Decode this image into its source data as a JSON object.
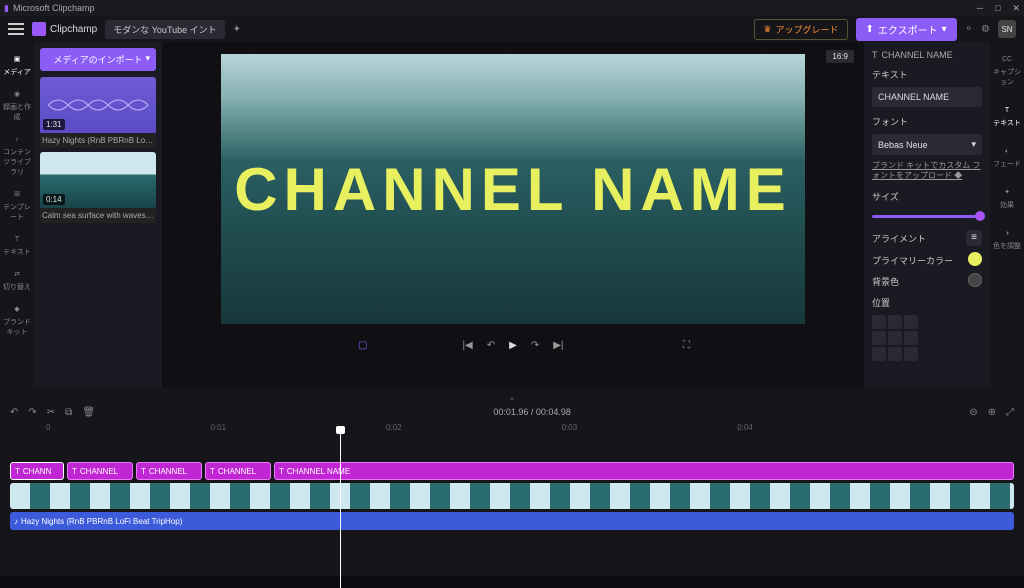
{
  "titlebar": {
    "app": "Microsoft Clipchamp"
  },
  "topbar": {
    "brand": "Clipchamp",
    "project": "モダンな YouTube イント",
    "upgrade": "アップグレード",
    "export": "エクスポート",
    "avatar": "SN"
  },
  "leftrail": {
    "items": [
      {
        "label": "メディア"
      },
      {
        "label": "録画と作成"
      },
      {
        "label": "コンテンツライブラリ"
      },
      {
        "label": "テンプレート"
      },
      {
        "label": "テキスト"
      },
      {
        "label": "切り替え"
      },
      {
        "label": "ブランドキット"
      }
    ]
  },
  "leftpanel": {
    "import": "メディアのインポート",
    "media": [
      {
        "dur": "1:31",
        "title": "Hazy Nights (RnB PBRnB LoFi Beat ..."
      },
      {
        "dur": "0:14",
        "title": "Calm sea surface with waves at sun..."
      }
    ]
  },
  "canvas": {
    "aspect": "16:9",
    "text": "CHANNEL NAME"
  },
  "transport": {
    "time_current": "00:01.96",
    "time_total": "00:04.98"
  },
  "rightrail": {
    "items": [
      {
        "label": "キャプション"
      },
      {
        "label": "テキスト"
      },
      {
        "label": "フェード"
      },
      {
        "label": "効果"
      },
      {
        "label": "色を調整"
      }
    ]
  },
  "rightpanel": {
    "header": "CHANNEL NAME",
    "text_label": "テキスト",
    "text_value": "CHANNEL NAME",
    "font_label": "フォント",
    "font_value": "Bebas Neue",
    "brand_link": "ブランド キットでカスタム フォントをアップロード",
    "size_label": "サイズ",
    "align_label": "アライメント",
    "primary_label": "プライマリーカラー",
    "primary_color": "#e8f060",
    "bg_label": "背景色",
    "bg_color": "#444",
    "pos_label": "位置"
  },
  "timeline": {
    "time_display": "00:01.96 / 00:04.98",
    "ruler": [
      "0",
      "0:01",
      "0:02",
      "0:03",
      "0:04"
    ],
    "text_clips": [
      "CHANN",
      "CHANNEL",
      "CHANNEL",
      "CHANNEL",
      "CHANNEL NAME"
    ],
    "audio_clip": "Hazy Nights (RnB PBRnB LoFi Beat TripHop)"
  }
}
